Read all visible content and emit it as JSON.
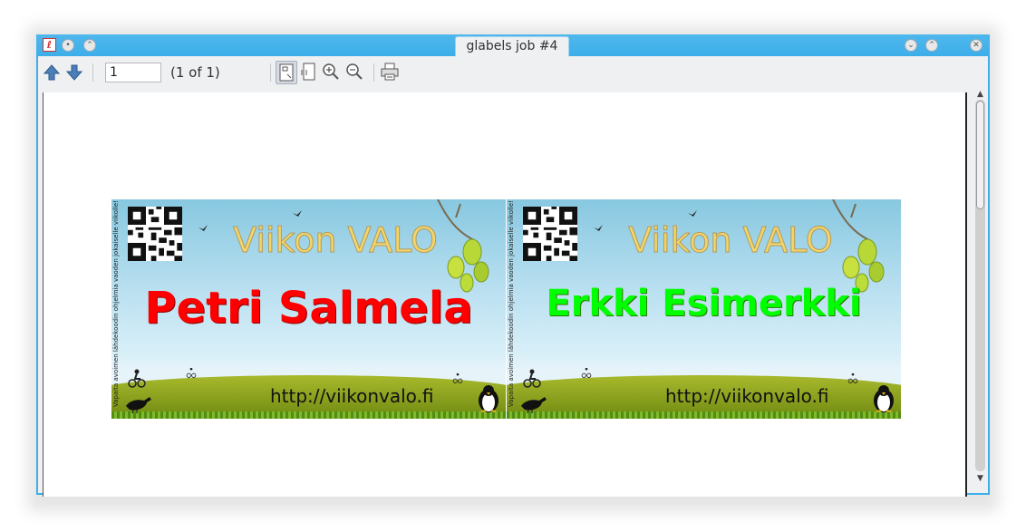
{
  "window": {
    "title": "glabels job #4",
    "app_icon": "glabels-icon",
    "accent_color": "#3daee9"
  },
  "toolbar": {
    "page_value": "1",
    "page_count": "(1 of 1)",
    "icons": [
      "previous-page-icon",
      "next-page-icon",
      "fit-page-icon",
      "fit-width-icon",
      "zoom-in-icon",
      "zoom-out-icon",
      "print-icon"
    ]
  },
  "labels": [
    {
      "brand": "Viikon VALO",
      "name": "Petri Salmela",
      "name_color": "#ff0000",
      "url": "http://viikonvalo.fi",
      "side_text": "Vapaita avoimen lähdekoodin ohjelmia vaoden jokaiselle viikolle!"
    },
    {
      "brand": "Viikon VALO",
      "name": "Erkki Esimerkki",
      "name_color": "#00ff00",
      "url": "http://viikonvalo.fi",
      "side_text": "Vapaita avoimen lähdekoodin ohjelmia vaoden jokaiselle viikolle!"
    }
  ]
}
